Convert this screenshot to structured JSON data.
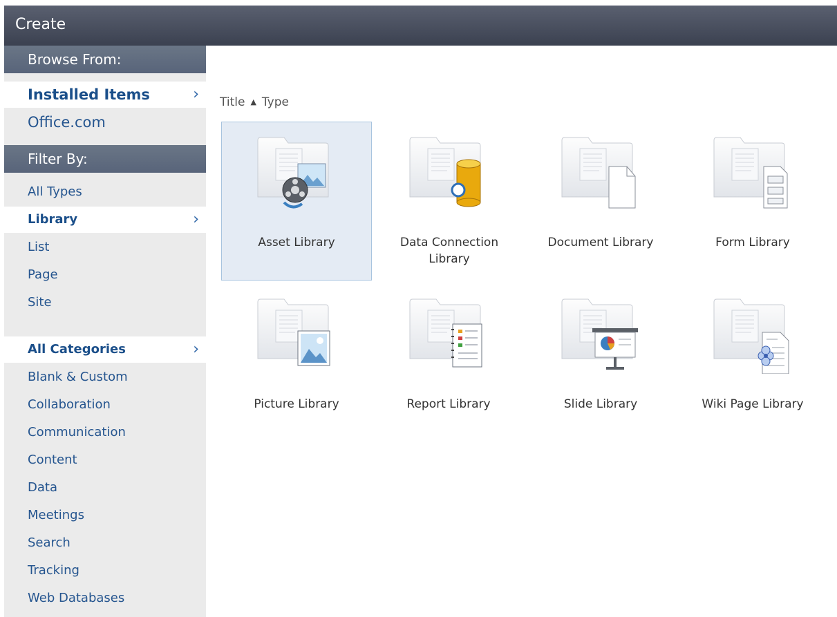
{
  "window": {
    "title": "Create"
  },
  "sidebar": {
    "browse_header": "Browse From:",
    "browse_items": [
      {
        "label": "Installed Items",
        "selected": true
      },
      {
        "label": "Office.com",
        "selected": false
      }
    ],
    "filter_header": "Filter By:",
    "type_items": [
      {
        "label": "All Types",
        "selected": false
      },
      {
        "label": "Library",
        "selected": true
      },
      {
        "label": "List",
        "selected": false
      },
      {
        "label": "Page",
        "selected": false
      },
      {
        "label": "Site",
        "selected": false
      }
    ],
    "category_items": [
      {
        "label": "All Categories",
        "selected": true
      },
      {
        "label": "Blank & Custom",
        "selected": false
      },
      {
        "label": "Collaboration",
        "selected": false
      },
      {
        "label": "Communication",
        "selected": false
      },
      {
        "label": "Content",
        "selected": false
      },
      {
        "label": "Data",
        "selected": false
      },
      {
        "label": "Meetings",
        "selected": false
      },
      {
        "label": "Search",
        "selected": false
      },
      {
        "label": "Tracking",
        "selected": false
      },
      {
        "label": "Web Databases",
        "selected": false
      }
    ],
    "chevron": "›"
  },
  "sort": {
    "title_label": "Title",
    "type_label": "Type",
    "direction": "ascending",
    "arrow": "▲"
  },
  "templates": [
    {
      "label": "Asset Library",
      "icon": "asset-library-icon",
      "selected": true
    },
    {
      "label": "Data Connection Library",
      "icon": "data-connection-library-icon",
      "selected": false
    },
    {
      "label": "Document Library",
      "icon": "document-library-icon",
      "selected": false
    },
    {
      "label": "Form Library",
      "icon": "form-library-icon",
      "selected": false
    },
    {
      "label": "Picture Library",
      "icon": "picture-library-icon",
      "selected": false
    },
    {
      "label": "Report Library",
      "icon": "report-library-icon",
      "selected": false
    },
    {
      "label": "Slide Library",
      "icon": "slide-library-icon",
      "selected": false
    },
    {
      "label": "Wiki Page Library",
      "icon": "wiki-page-library-icon",
      "selected": false
    }
  ],
  "colors": {
    "titlebar": "#4a505e",
    "section_header": "#627084",
    "link": "#25558f",
    "selected_tile": "#e4ebf4"
  }
}
